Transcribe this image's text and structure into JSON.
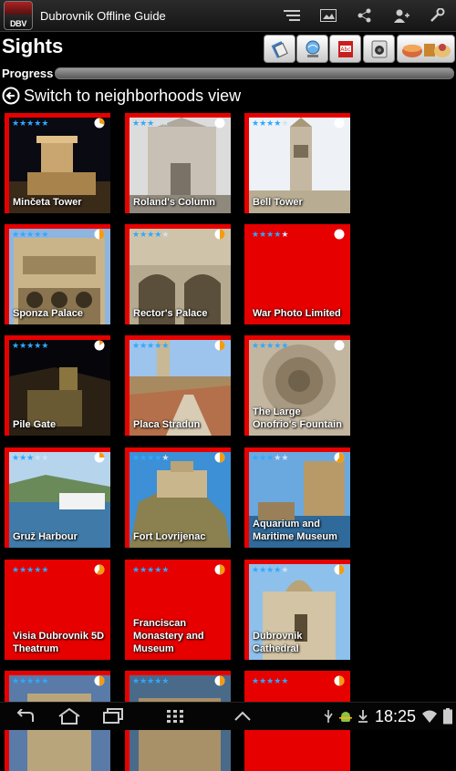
{
  "app": {
    "logo_text": "DBV",
    "title": "Dubrovnik Offline Guide"
  },
  "header": {
    "title": "Sights",
    "progress_label": "Progress",
    "progress_fraction": 0.0,
    "switch_label": "Switch to neighborhoods view"
  },
  "toolbar_icons": [
    "list-icon",
    "map-icon",
    "share-icon",
    "add-user-icon",
    "settings-icon"
  ],
  "tool_buttons": [
    "rotate-tool-icon",
    "globe-search-icon",
    "dictionary-icon",
    "audio-icon",
    "food-icon"
  ],
  "colors": {
    "tile_red": "#e60000",
    "star": "#2fa8ff",
    "progress": "#2e8fd3"
  },
  "tiles": [
    {
      "label": "Minčeta Tower",
      "stars": 5,
      "pie": 0.3,
      "photo": "tower-night"
    },
    {
      "label": "Roland's Column",
      "stars": 3,
      "pie": 0.0,
      "photo": "church"
    },
    {
      "label": "Bell Tower",
      "stars": 4,
      "pie": 0.0,
      "photo": "belltower"
    },
    {
      "label": "Sponza Palace",
      "stars": 5,
      "pie": 0.5,
      "photo": "palace"
    },
    {
      "label": "Rector's Palace",
      "stars": 4,
      "pie": 0.5,
      "photo": "arches"
    },
    {
      "label": "War Photo Limited",
      "stars": 4,
      "pie": 0.0,
      "photo": ""
    },
    {
      "label": "Pile Gate",
      "stars": 5,
      "pie": 0.15,
      "photo": "gate-night"
    },
    {
      "label": "Placa Stradun",
      "stars": 5,
      "pie": 0.5,
      "photo": "street"
    },
    {
      "label": "The Large Onofrio's Fountain",
      "stars": 5,
      "pie": 0.0,
      "photo": "fountain"
    },
    {
      "label": "Gruž Harbour",
      "stars": 3,
      "pie": 0.25,
      "photo": "harbour"
    },
    {
      "label": "Fort Lovrijenac",
      "stars": 4,
      "pie": 0.5,
      "photo": "fort"
    },
    {
      "label": "Aquarium and Maritime Museum",
      "stars": 3,
      "pie": 0.6,
      "photo": "aquarium"
    },
    {
      "label": "Visia Dubrovnik 5D Theatrum",
      "stars": 5,
      "pie": 0.6,
      "photo": ""
    },
    {
      "label": "Franciscan Monastery and Museum",
      "stars": 5,
      "pie": 0.5,
      "photo": ""
    },
    {
      "label": "Dubrovnik Cathedral",
      "stars": 4,
      "pie": 0.5,
      "photo": "cathedral"
    },
    {
      "label": "",
      "stars": 5,
      "pie": 0.5,
      "photo": "partial1"
    },
    {
      "label": "",
      "stars": 5,
      "pie": 0.5,
      "photo": "partial2"
    },
    {
      "label": "",
      "stars": 5,
      "pie": 0.5,
      "photo": ""
    }
  ],
  "navbar": {
    "buttons": [
      "back-icon",
      "home-icon",
      "recent-apps-icon",
      "apps-grid-icon",
      "up-arrow-icon"
    ]
  },
  "status": {
    "time": "18:25",
    "icons": [
      "usb-icon",
      "android-debug-icon",
      "download-icon",
      "wifi-icon",
      "battery-icon"
    ]
  }
}
